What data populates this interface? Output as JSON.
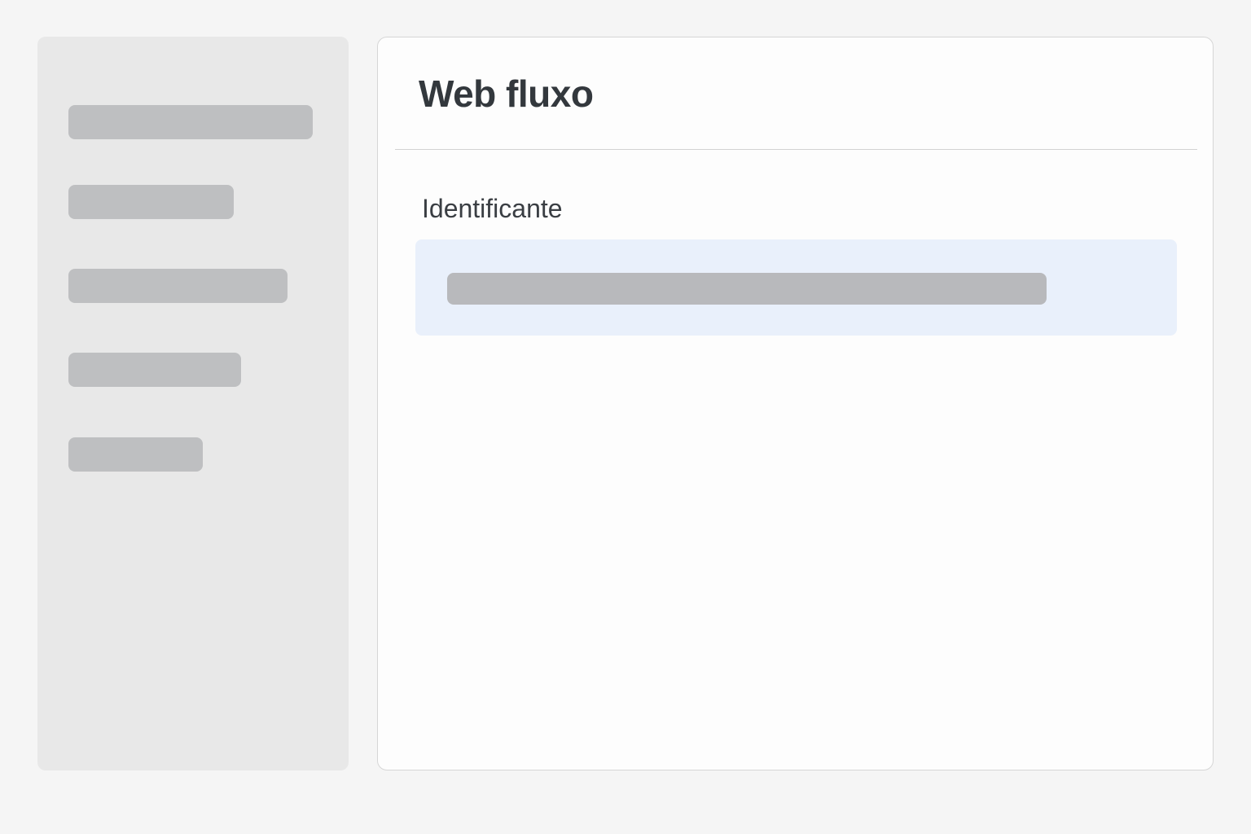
{
  "sidebar": {
    "items": [
      {
        "label": ""
      },
      {
        "label": ""
      },
      {
        "label": ""
      },
      {
        "label": ""
      },
      {
        "label": ""
      }
    ]
  },
  "main": {
    "title": "Web fluxo",
    "field": {
      "label": "Identificante",
      "value": ""
    }
  },
  "colors": {
    "background": "#f5f5f5",
    "sidebar": "#e8e8e8",
    "placeholder_bar": "#bebfc1",
    "field_highlight": "#e9f0fb",
    "title_text": "#33383d"
  }
}
